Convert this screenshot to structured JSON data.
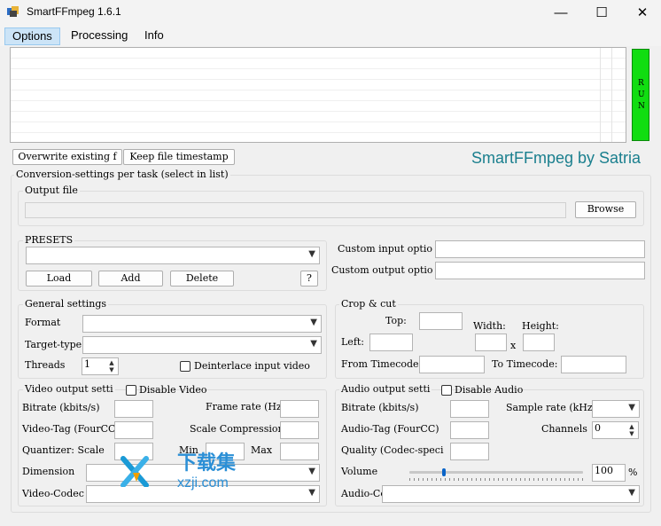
{
  "window": {
    "title": "SmartFFmpeg 1.6.1",
    "minimize": "—",
    "maximize": "☐",
    "close": "✕"
  },
  "menu": [
    "Options",
    "Processing",
    "Info"
  ],
  "run_label": "RUN",
  "top_buttons": {
    "overwrite": "Overwrite existing f",
    "keep_timestamp": "Keep file timestamp"
  },
  "brand": "SmartFFmpeg by Satria",
  "conversion": {
    "legend": "Conversion-settings per task (select in list)"
  },
  "output_file": {
    "legend": "Output file",
    "value": "",
    "browse": "Browse"
  },
  "presets": {
    "legend": "PRESETS",
    "selected": "",
    "load": "Load",
    "add": "Add",
    "delete": "Delete",
    "help": "?"
  },
  "custom": {
    "input_label": "Custom input optio",
    "output_label": "Custom output optio",
    "input_value": "",
    "output_value": ""
  },
  "general": {
    "legend": "General settings",
    "format_label": "Format",
    "format_value": "",
    "target_label": "Target-type",
    "target_value": "",
    "threads_label": "Threads",
    "threads_value": "1",
    "deinterlace_label": "Deinterlace input video",
    "deinterlace_checked": false
  },
  "crop": {
    "legend": "Crop & cut",
    "top_label": "Top:",
    "left_label": "Left:",
    "width_label": "Width:",
    "height_label": "Height:",
    "x_label": "x",
    "from_label": "From Timecode:",
    "to_label": "To Timecode:"
  },
  "video": {
    "legend": "Video output setti",
    "disable_label": "Disable Video",
    "disable_checked": false,
    "bitrate_label": "Bitrate (kbits/s)",
    "framerate_label": "Frame rate (Hz",
    "tag_label": "Video-Tag (FourCC)",
    "scale_comp_label": "Scale Compression",
    "quantizer_label": "Quantizer: Scale",
    "min_label": "Min",
    "max_label": "Max",
    "dimension_label": "Dimension",
    "dimension_value": "",
    "codec_label": "Video-Codec",
    "codec_value": ""
  },
  "audio": {
    "legend": "Audio output setti",
    "disable_label": "Disable Audio",
    "disable_checked": false,
    "bitrate_label": "Bitrate (kbits/s)",
    "samplerate_label": "Sample rate (kHz",
    "tag_label": "Audio-Tag (FourCC)",
    "channels_label": "Channels",
    "channels_value": "0",
    "quality_label": "Quality (Codec-speci",
    "volume_label": "Volume",
    "volume_value": "100",
    "volume_unit": "%",
    "volume_level": 0.2,
    "codec_label": "Audio-Codec",
    "codec_value": ""
  },
  "watermark": {
    "text_cn": "下载集",
    "text_url": "xzji.com"
  },
  "colors": {
    "run": "#11dd11",
    "brand": "#1a7f8e",
    "menu_active": "#cce4f7"
  }
}
